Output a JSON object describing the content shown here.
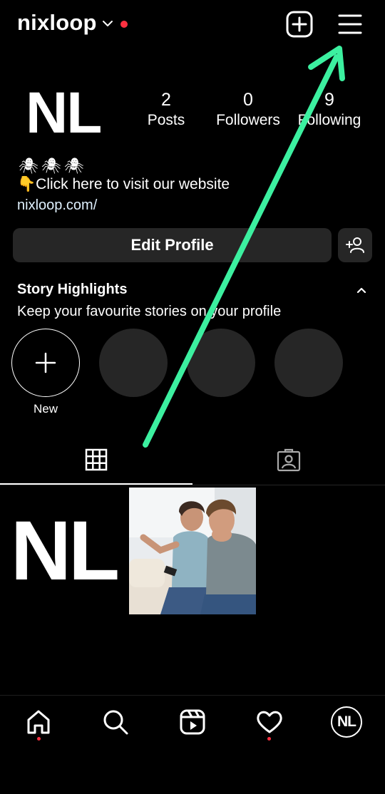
{
  "header": {
    "username": "nixloop"
  },
  "profile": {
    "avatar_text": "NL",
    "stats": [
      {
        "value": "2",
        "label": "Posts"
      },
      {
        "value": "0",
        "label": "Followers"
      },
      {
        "value": "9",
        "label": "Following"
      }
    ],
    "bio_emojis": "🕷🕷🕷",
    "bio_line": "👇Click here to visit our website",
    "bio_link": "nixloop.com/",
    "edit_profile_label": "Edit Profile"
  },
  "highlights": {
    "title": "Story Highlights",
    "subtitle": "Keep your favourite stories on your profile",
    "new_label": "New"
  },
  "grid": {
    "post_1_text": "NL"
  },
  "nav": {
    "profile_avatar_text": "NL"
  },
  "colors": {
    "accent_red": "#ff3040",
    "annotation_green": "#3cf0a0",
    "button_bg": "#262626"
  }
}
